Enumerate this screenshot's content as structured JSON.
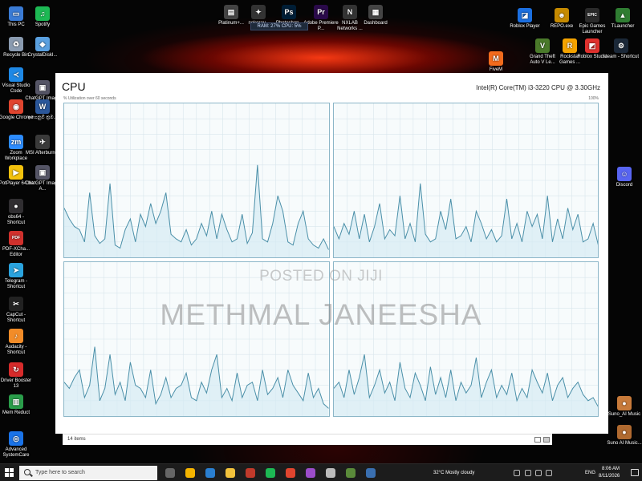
{
  "desktop": {
    "left_icons": [
      {
        "label": "This PC",
        "glyph": "▭",
        "color": "#3a7bd5",
        "icon": "computer-icon"
      },
      {
        "label": "Spotify",
        "glyph": "♫",
        "color": "#1db954",
        "icon": "spotify-icon"
      },
      {
        "label": "Recycle Bin",
        "glyph": "♻",
        "color": "#8a9bb0",
        "icon": "recycle-bin-icon"
      },
      {
        "label": "CrystalDiskI...",
        "glyph": "◆",
        "color": "#5aa0e0",
        "icon": "crystaldisk-icon"
      },
      {
        "label": "Visual Studio Code",
        "glyph": "≺",
        "color": "#1e88e5",
        "icon": "vscode-icon"
      },
      {
        "label": "ChatGPT Image A...",
        "glyph": "▣",
        "color": "#556",
        "icon": "image-file-icon"
      },
      {
        "label": "Google Chrome",
        "glyph": "◉",
        "color": "#e0452f",
        "icon": "chrome-icon"
      },
      {
        "label": "ඉගෙනුම් ක්‍රම...",
        "glyph": "W",
        "color": "#2b579a",
        "icon": "word-doc-icon"
      },
      {
        "label": "Zoom Workplace",
        "glyph": "zm",
        "color": "#2d8cff",
        "icon": "zoom-icon"
      },
      {
        "label": "MSI Afterburner",
        "glyph": "✈",
        "color": "#3a3a3a",
        "icon": "msi-afterburner-icon"
      },
      {
        "label": "PotPlayer 64 bit",
        "glyph": "▶",
        "color": "#f4c20d",
        "icon": "potplayer-icon"
      },
      {
        "label": "ChatGPT Image A...",
        "glyph": "▣",
        "color": "#556",
        "icon": "image-file-icon"
      },
      {
        "label": "obs64 - Shortcut",
        "glyph": "●",
        "color": "#302e31",
        "icon": "obs-icon"
      },
      {
        "label": "PDF-XCha... Editor",
        "glyph": "PDF",
        "color": "#d0312d",
        "icon": "pdf-icon"
      },
      {
        "label": "Telegram - Shortcut",
        "glyph": "➤",
        "color": "#2aa3de",
        "icon": "telegram-icon"
      },
      {
        "label": "CapCut - Shortcut",
        "glyph": "✂",
        "color": "#222",
        "icon": "capcut-icon"
      },
      {
        "label": "Audacity - Shortcut",
        "glyph": "♪",
        "color": "#f28c28",
        "icon": "audacity-icon"
      },
      {
        "label": "Driver Booster 13",
        "glyph": "↻",
        "color": "#d62b2b",
        "icon": "driver-booster-icon"
      },
      {
        "label": "Mem Reduct",
        "glyph": "▥",
        "color": "#2a9d4a",
        "icon": "mem-reduct-icon"
      },
      {
        "label": "Advanced SystemCare",
        "glyph": "◎",
        "color": "#1a73e8",
        "icon": "systemcare-icon"
      }
    ],
    "top_icons": [
      {
        "label": "Platinum+...",
        "glyph": "▤",
        "color": "#444",
        "icon": "app-icon"
      },
      {
        "label": "nekoray -",
        "glyph": "✦",
        "color": "#333",
        "icon": "nekoray-icon"
      },
      {
        "label": "Photoshop -",
        "glyph": "Ps",
        "color": "#001e36",
        "icon": "photoshop-icon"
      },
      {
        "label": "Adobe Premiere P...",
        "glyph": "Pr",
        "color": "#2a0a4a",
        "icon": "premiere-icon"
      },
      {
        "label": "NXLAB Networks ...",
        "glyph": "N",
        "color": "#333",
        "icon": "nxlab-icon"
      },
      {
        "label": "Dashboard",
        "glyph": "▦",
        "color": "#444",
        "icon": "dashboard-icon"
      }
    ],
    "status_strip": "RAM: 27%  CPU: 5%",
    "right_icons": [
      {
        "label": "Roblox Player",
        "glyph": "◪",
        "color": "#1b6fe0",
        "icon": "roblox-icon"
      },
      {
        "label": "REPO.exe",
        "glyph": "☻",
        "color": "#c58a00",
        "icon": "repo-icon"
      },
      {
        "label": "Epic Games Launcher",
        "glyph": "EPIC",
        "color": "#2a2a2a",
        "icon": "epic-games-icon"
      },
      {
        "label": "TLauncher",
        "glyph": "▲",
        "color": "#2f7d32",
        "icon": "tlauncher-icon"
      },
      {
        "label": "FiveM",
        "glyph": "M",
        "color": "#f26b1d",
        "icon": "fivem-icon"
      },
      {
        "label": "Grand Theft Auto V Le...",
        "glyph": "V",
        "color": "#4a7a2a",
        "icon": "gta-icon"
      },
      {
        "label": "Rockstar Games ...",
        "glyph": "R",
        "color": "#f4a300",
        "icon": "rockstar-icon"
      },
      {
        "label": "Roblox Studio",
        "glyph": "◩",
        "color": "#e0312d",
        "icon": "roblox-studio-icon"
      },
      {
        "label": "steam - Shortcut",
        "glyph": "⚙",
        "color": "#1b2838",
        "icon": "steam-icon"
      },
      {
        "label": "Discord",
        "glyph": "☺",
        "color": "#5865f2",
        "icon": "discord-icon"
      },
      {
        "label": "Suno_AI Music",
        "glyph": "●",
        "color": "#c77a3a",
        "icon": "suno-icon"
      },
      {
        "label": "Suno AI Music...",
        "glyph": "●",
        "color": "#b06a30",
        "icon": "suno-icon"
      }
    ]
  },
  "cpu": {
    "title": "CPU",
    "model": "Intel(R) Core(TM) i3-3220 CPU @ 3.30GHz",
    "axis_left": "% Utilization over 60 seconds",
    "axis_right": "100%",
    "line_color": "#4a8fa8",
    "fill_color": "#d6ebf3",
    "grid_color": "#d8e6ec",
    "panels": [
      {
        "name": "core-0",
        "utilization": [
          32,
          25,
          20,
          18,
          10,
          42,
          14,
          9,
          12,
          48,
          8,
          6,
          18,
          25,
          10,
          28,
          20,
          35,
          22,
          30,
          42,
          15,
          12,
          10,
          18,
          8,
          12,
          22,
          14,
          30,
          12,
          28,
          18,
          10,
          12,
          28,
          9,
          16,
          60,
          12,
          10,
          22,
          40,
          30,
          10,
          8,
          22,
          30,
          12,
          8,
          6,
          12,
          5
        ]
      },
      {
        "name": "core-1",
        "utilization": [
          20,
          12,
          22,
          15,
          30,
          12,
          28,
          10,
          20,
          35,
          12,
          18,
          14,
          40,
          12,
          22,
          10,
          48,
          15,
          10,
          12,
          30,
          18,
          38,
          12,
          14,
          20,
          10,
          30,
          22,
          12,
          18,
          10,
          14,
          38,
          12,
          22,
          10,
          30,
          20,
          28,
          12,
          40,
          10,
          25,
          12,
          32,
          18,
          28,
          10,
          12,
          22,
          8
        ]
      },
      {
        "name": "core-2",
        "utilization": [
          22,
          18,
          25,
          30,
          12,
          20,
          45,
          10,
          18,
          40,
          14,
          22,
          10,
          35,
          20,
          18,
          12,
          30,
          8,
          14,
          25,
          12,
          18,
          20,
          28,
          12,
          10,
          22,
          15,
          30,
          40,
          12,
          18,
          10,
          28,
          12,
          20,
          22,
          10,
          30,
          14,
          18,
          25,
          12,
          30,
          20,
          15,
          10,
          28,
          12,
          18,
          8,
          5
        ]
      },
      {
        "name": "core-3",
        "utilization": [
          18,
          22,
          12,
          30,
          14,
          25,
          40,
          12,
          20,
          30,
          15,
          22,
          10,
          35,
          18,
          12,
          28,
          20,
          10,
          32,
          14,
          25,
          12,
          30,
          10,
          22,
          15,
          20,
          38,
          12,
          22,
          30,
          12,
          20,
          14,
          28,
          10,
          18,
          12,
          30,
          22,
          15,
          28,
          10,
          20,
          25,
          12,
          18,
          22,
          14,
          10,
          12,
          6
        ]
      }
    ]
  },
  "status_bar": {
    "items_count": "14 items"
  },
  "watermark": {
    "line1": "POSTED ON JIJI",
    "line2": "METHMAL JANEESHA"
  },
  "taskbar": {
    "search_placeholder": "Type here to search",
    "apps": [
      {
        "icon": "task-view-icon",
        "color": "#666"
      },
      {
        "icon": "ie-icon",
        "color": "#f4b400"
      },
      {
        "icon": "ccleaner-icon",
        "color": "#2a7fd0"
      },
      {
        "icon": "explorer-icon",
        "color": "#f2c23c"
      },
      {
        "icon": "media-icon",
        "color": "#c03a2b"
      },
      {
        "icon": "spotify-task-icon",
        "color": "#1db954"
      },
      {
        "icon": "chrome-task-icon",
        "color": "#e0452f"
      },
      {
        "icon": "messenger-icon",
        "color": "#9b4dca"
      },
      {
        "icon": "photos-icon",
        "color": "#bbbbbb"
      },
      {
        "icon": "app-task-icon",
        "color": "#5a8a3a"
      },
      {
        "icon": "app-task-icon-2",
        "color": "#3a6fb0"
      }
    ],
    "weather": "32°C  Mostly cloudy",
    "language": "ENG",
    "time": "8:06 AM",
    "date": "8/11/2026"
  }
}
